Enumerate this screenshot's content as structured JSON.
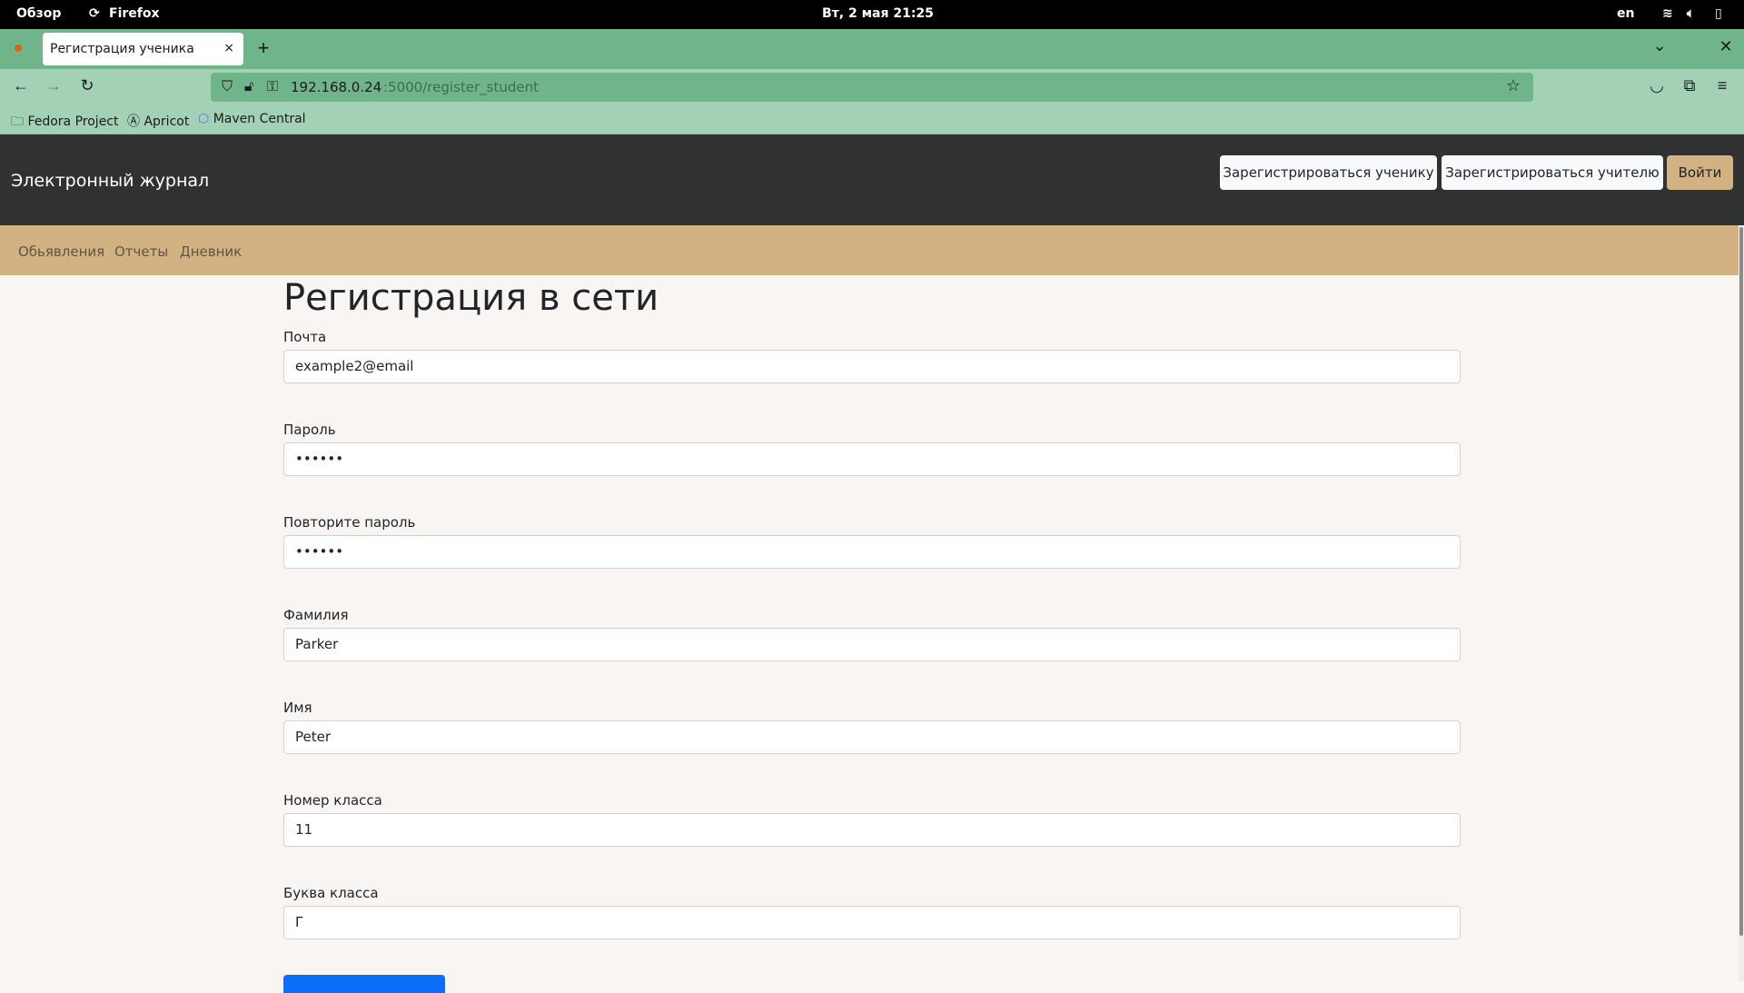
{
  "system": {
    "overview": "Обзор",
    "app": "Firefox",
    "datetime": "Вт, 2 мая  21:25",
    "lang": "en"
  },
  "browser": {
    "tab_title": "Регистрация ученика",
    "url_host": "192.168.0.24",
    "url_path": ":5000/register_student",
    "bookmarks": [
      "Fedora Project",
      "Apricot",
      "Maven Central"
    ]
  },
  "site": {
    "brand": "Электронный журнал",
    "buttons": {
      "register_student": "Зарегистрироваться ученику",
      "register_teacher": "Зарегистрироваться учителю",
      "login": "Войти"
    },
    "nav": [
      "Обьявления",
      "Отчеты",
      "Дневник"
    ]
  },
  "form": {
    "title": "Регистрация в сети",
    "fields": [
      {
        "label": "Почта",
        "value": "example2@email"
      },
      {
        "label": "Пароль",
        "value": "••••••"
      },
      {
        "label": "Повторите пароль",
        "value": "••••••"
      },
      {
        "label": "Фамилия",
        "value": "Parker"
      },
      {
        "label": "Имя",
        "value": "Peter"
      },
      {
        "label": "Номер класса",
        "value": "11"
      },
      {
        "label": "Буква класса",
        "value": "Г"
      }
    ]
  },
  "colors": {
    "header": "#303231",
    "subnav": "#d2b283",
    "browser": "#6fb48a",
    "submit": "#0d6efd"
  }
}
